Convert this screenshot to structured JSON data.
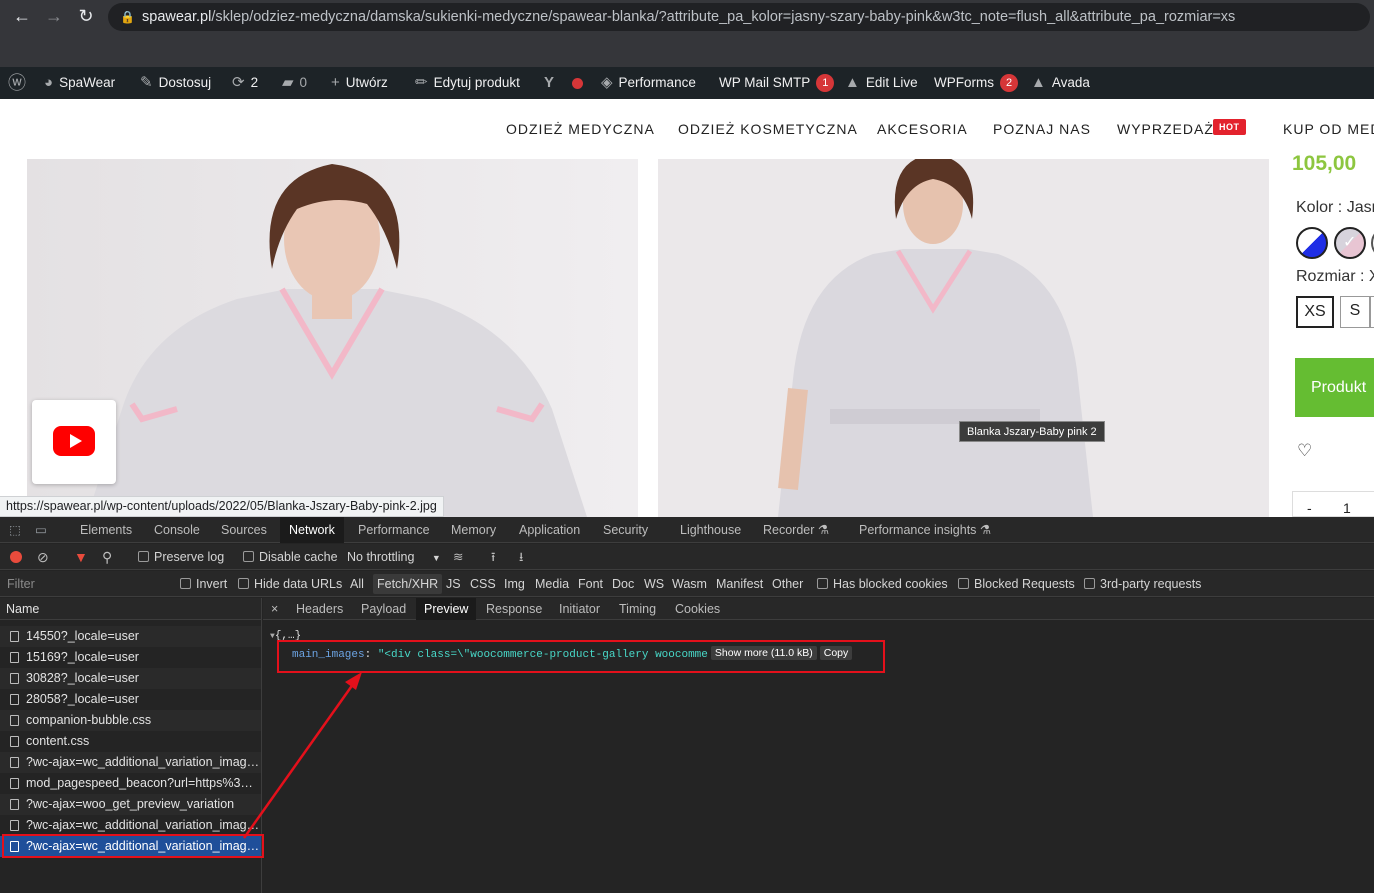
{
  "browser": {
    "url_host": "spawear.pl",
    "url_path": "/sklep/odziez-medyczna/damska/sukienki-medyczne/spawear-blanka/?attribute_pa_kolor=jasny-szary-baby-pink&w3tc_note=flush_all&attribute_pa_rozmiar=xs"
  },
  "adminbar": {
    "site": "SpaWear",
    "customize": "Dostosuj",
    "updates": "2",
    "comments": "0",
    "new": "Utwórz",
    "edit_product": "Edytuj produkt",
    "performance": "Performance",
    "mail_smtp": "WP Mail SMTP",
    "mail_smtp_count": "1",
    "edit_live": "Edit Live",
    "wpforms": "WPForms",
    "wpforms_count": "2",
    "avada": "Avada"
  },
  "nav": {
    "items": [
      "ODZIEŻ MEDYCZNA",
      "ODZIEŻ KOSMETYCZNA",
      "AKCESORIA",
      "POZNAJ NAS",
      "WYPRZEDAŻ",
      "KUP OD MEDY"
    ],
    "hot_badge": "HOT"
  },
  "product": {
    "price": "105,00",
    "color_label": "Kolor : Jasn",
    "size_label": "Rozmiar : X",
    "sizes": [
      "XS",
      "S"
    ],
    "add_button": "Produkt",
    "qty_minus": "-",
    "qty_value": "1",
    "image_tooltip": "Blanka Jszary-Baby pink 2"
  },
  "status_url": "https://spawear.pl/wp-content/uploads/2022/05/Blanka-Jszary-Baby-pink-2.jpg",
  "devtools": {
    "tabs": [
      "Elements",
      "Console",
      "Sources",
      "Network",
      "Performance",
      "Memory",
      "Application",
      "Security",
      "Lighthouse",
      "Recorder",
      "Performance insights"
    ],
    "toolbar": {
      "preserve_log": "Preserve log",
      "disable_cache": "Disable cache",
      "throttling": "No throttling"
    },
    "filter": {
      "placeholder": "Filter",
      "invert": "Invert",
      "hide_data_urls": "Hide data URLs",
      "types": [
        "All",
        "Fetch/XHR",
        "JS",
        "CSS",
        "Img",
        "Media",
        "Font",
        "Doc",
        "WS",
        "Wasm",
        "Manifest",
        "Other"
      ],
      "blocked_cookies": "Has blocked cookies",
      "blocked_requests": "Blocked Requests",
      "third_party": "3rd-party requests"
    },
    "name_header": "Name",
    "requests": [
      "14550?_locale=user",
      "15169?_locale=user",
      "30828?_locale=user",
      "28058?_locale=user",
      "companion-bubble.css",
      "content.css",
      "?wc-ajax=wc_additional_variation_imag…",
      "mod_pagespeed_beacon?url=https%3A…",
      "?wc-ajax=woo_get_preview_variation",
      "?wc-ajax=wc_additional_variation_imag…",
      "?wc-ajax=wc_additional_variation_imag…"
    ],
    "subtabs": [
      "Headers",
      "Payload",
      "Preview",
      "Response",
      "Initiator",
      "Timing",
      "Cookies"
    ],
    "preview": {
      "root": "{,…}",
      "key": "main_images",
      "value": "\"<div class=\\\"woocommerce-product-gallery woocomme",
      "show_more": "Show more (11.0 kB)",
      "copy": "Copy"
    }
  },
  "colors": {
    "accent_green": "#8dc63f",
    "button_green": "#65bd32",
    "annotation_red": "#e4101b",
    "hot_red": "#e3222d"
  }
}
